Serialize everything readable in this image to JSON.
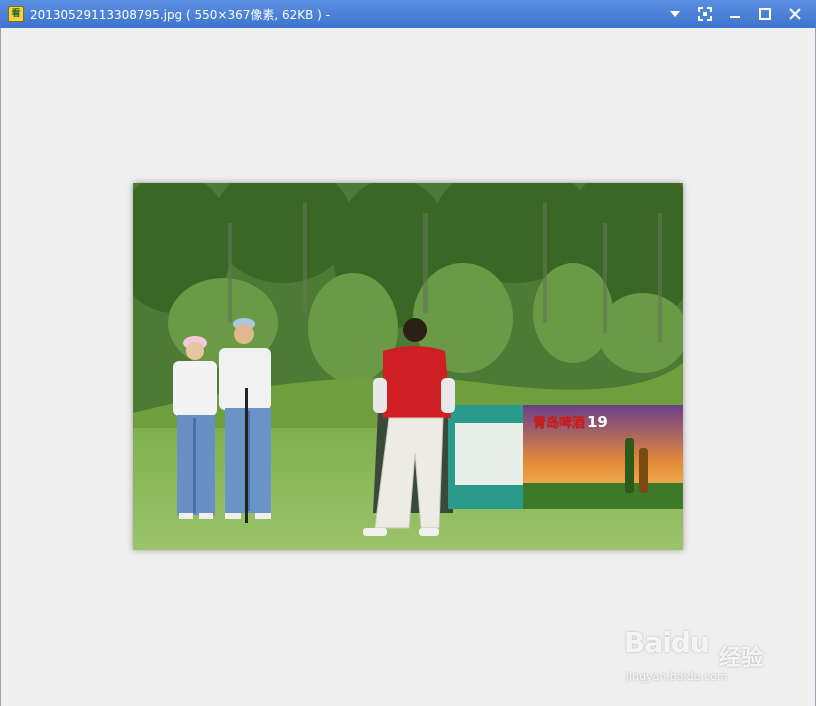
{
  "window": {
    "title": "20130529113308795.jpg ( 550×367像素, 62KB ) -",
    "app_icon": "image-viewer-icon",
    "app_icon_glyph": "看"
  },
  "controls": [
    {
      "name": "dropdown-icon"
    },
    {
      "name": "fullscreen-icon"
    },
    {
      "name": "minimize-icon"
    },
    {
      "name": "maximize-icon"
    },
    {
      "name": "close-icon"
    }
  ],
  "photo": {
    "sign_text": "青岛啤酒",
    "sign_number": "19"
  },
  "watermark": {
    "logo": "Baidu",
    "cn": "经验",
    "url": "jingyan.baidu.com"
  },
  "colors": {
    "titlebar": "#4a80d8",
    "background": "#efefef"
  }
}
